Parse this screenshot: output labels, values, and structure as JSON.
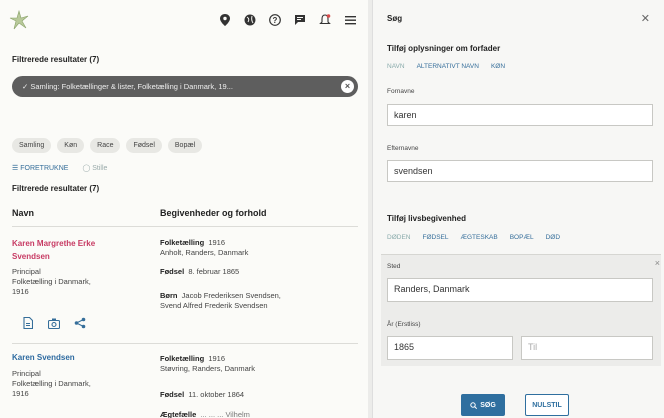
{
  "left": {
    "filter_title": "Filtrerede resultater (7)",
    "collection_pill": "✓ Samling: Folketællinger & lister, Folketælling i Danmark, 19...",
    "chips": [
      "Samling",
      "Køn",
      "Race",
      "Fødsel",
      "Bopæl"
    ],
    "sort_link": "☰ FORETRUKNE",
    "sort_link2": "◯ Stille",
    "filter_title2": "Filtrerede resultater (7)",
    "col_name": "Navn",
    "col_events": "Begivenheder og forhold",
    "records": [
      {
        "name_line1": "Karen Margrethe Erke",
        "name_line2": "Svendsen",
        "role": "Principal",
        "collection": "Folketælling i Danmark,",
        "year": "1916",
        "ev1_label": "Folketælling",
        "ev1_year": "1916",
        "ev1_place": "Anholt, Randers, Danmark",
        "ev2_label": "Fødsel",
        "ev2_value": "8. februar 1865",
        "ev3_label": "Børn",
        "ev3_value": "Jacob Frederiksen Svendsen,",
        "ev3_value2": "Svend Alfred Frederik Svendsen"
      },
      {
        "name_line1": "Karen Svendsen",
        "role": "Principal",
        "collection": "Folketælling i Danmark,",
        "year": "1916",
        "ev1_label": "Folketælling",
        "ev1_year": "1916",
        "ev1_place": "Støvring, Randers, Danmark",
        "ev2_label": "Fødsel",
        "ev2_value": "11. oktober 1864",
        "ev3_label": "Ægtefælle",
        "ev3_value": "... ... ... Vilhelm"
      }
    ]
  },
  "right": {
    "title": "Søg",
    "close": "✕",
    "section1": "Tilføj oplysninger om forfader",
    "tabs1": [
      "NAVN",
      "ALTERNATIVT NAVN",
      "KØN"
    ],
    "firstname_label": "Fornavne",
    "firstname_value": "karen",
    "lastname_label": "Efternavne",
    "lastname_value": "svendsen",
    "section2": "Tilføj livsbegivenhed",
    "tabs2": [
      "DØDEN",
      "FØDSEL",
      "ÆGTESKAB",
      "BOPÆL",
      "DØD"
    ],
    "place_label": "Sted",
    "place_value": "Randers, Danmark",
    "year_label": "År (Erstliss)",
    "year_from": "1865",
    "year_to_placeholder": "Til",
    "search_button": "SØG",
    "reset_button": "NULSTIL"
  }
}
